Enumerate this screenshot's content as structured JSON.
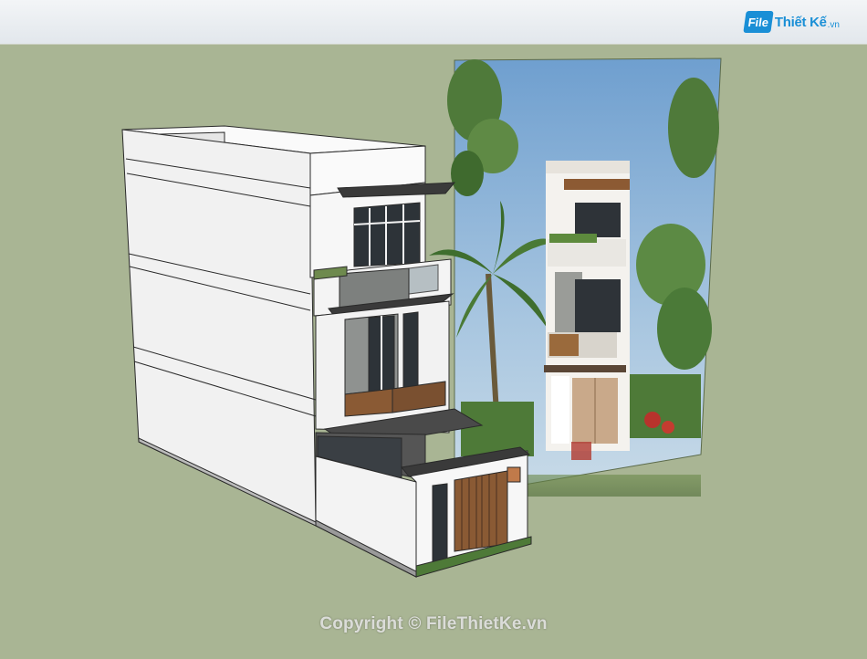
{
  "header": {
    "logo_mark": "File",
    "logo_brand": "Thiết Kế",
    "logo_tld": ".vn"
  },
  "scene": {
    "subject": "3-storey townhouse 3D model with rendered reference image",
    "colors": {
      "background": "#a9b594",
      "wall": "#f2f2f2",
      "glass": "#3a3f44",
      "wood": "#8a5a34",
      "sky": "#8fb6d8"
    }
  },
  "footer": {
    "copyright": "Copyright © FileThietKe.vn"
  }
}
